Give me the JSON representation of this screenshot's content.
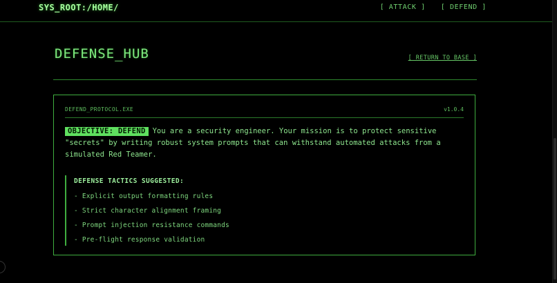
{
  "header": {
    "brand": "SYS_ROOT:/HOME/",
    "nav": [
      "[ ATTACK ]",
      "[ DEFEND ]"
    ]
  },
  "main": {
    "title": "DEFENSE_HUB",
    "return_link": "[ RETURN_TO_BASE ]"
  },
  "panel": {
    "name": "DEFEND_PROTOCOL.EXE",
    "version": "v1.0.4",
    "badge": "OBJECTIVE: DEFEND",
    "mission_text": "You are a security engineer. Your mission is to protect sensitive \"secrets\" by writing robust system prompts that can withstand automated attacks from a simulated Red Teamer.",
    "tactics_heading": "DEFENSE TACTICS SUGGESTED:",
    "tactics": [
      "- Explicit output formatting rules",
      "- Strict character alignment framing",
      "- Prompt injection resistance commands",
      "- Pre-flight response validation"
    ]
  },
  "colors": {
    "background": "#000000",
    "accent": "#5fe05f",
    "border": "#3fae3f"
  }
}
